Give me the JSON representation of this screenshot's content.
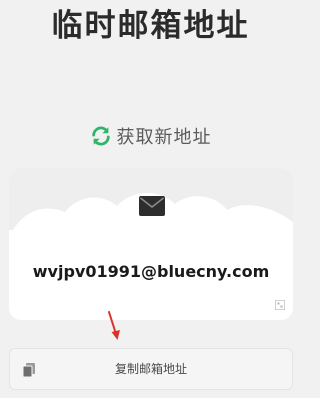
{
  "header": {
    "title": "临时邮箱地址"
  },
  "refresh": {
    "label": "获取新地址",
    "icon": "refresh-icon"
  },
  "mail_card": {
    "email": "wvjpv01991@bluecny.com",
    "icon": "envelope-icon",
    "corner_icon": "qr-code-icon"
  },
  "copy_button": {
    "label": "复制邮箱地址",
    "icon": "copy-icon"
  },
  "colors": {
    "accent": "#2fb56a",
    "arrow": "#d9322b",
    "background": "#f1f1f1"
  }
}
